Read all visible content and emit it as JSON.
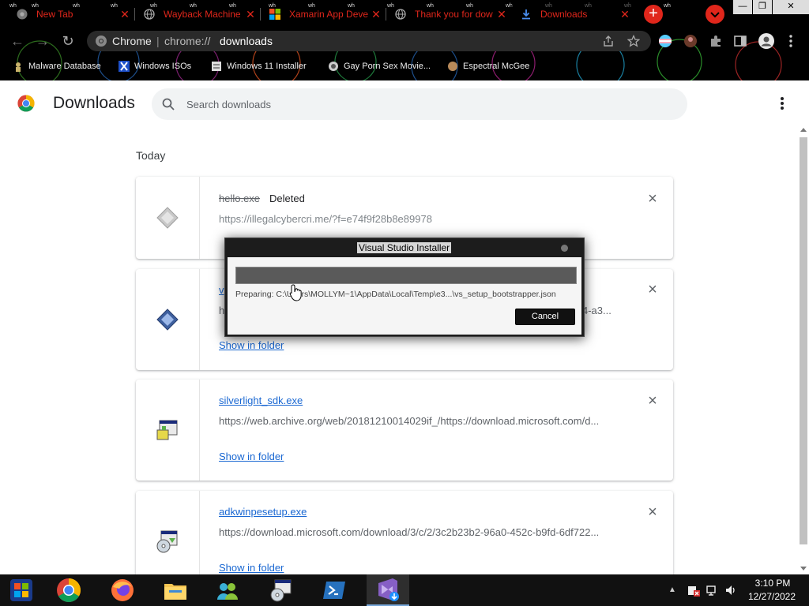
{
  "browser": {
    "tabs": [
      {
        "title": "New Tab",
        "icon": "chrome-icon",
        "active": false
      },
      {
        "title": "Wayback Machine",
        "icon": "globe-icon",
        "active": false
      },
      {
        "title": "Xamarin App Deve",
        "icon": "microsoft-icon",
        "active": false
      },
      {
        "title": "Thank you for dow",
        "icon": "globe-icon",
        "active": false
      },
      {
        "title": "Downloads",
        "icon": "download-icon",
        "active": true
      }
    ],
    "omnibox": {
      "site_label": "Chrome",
      "divider": "|",
      "url_scheme": "chrome://",
      "url_host": "downloads"
    },
    "bookmarks": [
      {
        "label": "Malware Database",
        "icon": "bug-icon"
      },
      {
        "label": "Windows ISOs",
        "icon": "x-logo-icon"
      },
      {
        "label": "Windows 11 Installer",
        "icon": "page-icon"
      },
      {
        "label": "Gay Porn Sex Movie...",
        "icon": "site-icon"
      },
      {
        "label": "Espectral McGee",
        "icon": "site-icon"
      }
    ],
    "theme_color": "#e0261b"
  },
  "downloads": {
    "title": "Downloads",
    "search_placeholder": "Search downloads",
    "section": "Today",
    "show_in_folder": "Show in folder",
    "items": [
      {
        "name": "hello.exe",
        "status": "Deleted",
        "url": "https://illegalcybercri.me/?f=e74f9f28b8e89978",
        "deleted": true
      },
      {
        "name": "v",
        "status": "",
        "url": "h",
        "url_tail": "4-a3...",
        "deleted": false
      },
      {
        "name": "silverlight_sdk.exe",
        "status": "",
        "url": "https://web.archive.org/web/20181210014029if_/https://download.microsoft.com/d...",
        "deleted": false
      },
      {
        "name": "adkwinpesetup.exe",
        "status": "",
        "url": "https://download.microsoft.com/download/3/c/2/3c2b23b2-96a0-452c-b9fd-6df722...",
        "deleted": false
      }
    ],
    "link_color": "#1967d2"
  },
  "installer": {
    "title": "Visual Studio Installer",
    "status": "Preparing: C:\\Users\\MOLLYM~1\\AppData\\Local\\Temp\\e3...\\vs_setup_bootstrapper.json",
    "cancel": "Cancel"
  },
  "taskbar": {
    "apps": [
      "start-icon",
      "chrome-icon",
      "firefox-icon",
      "file-explorer-icon",
      "people-icon",
      "installer-icon",
      "powershell-icon",
      "visual-studio-icon"
    ],
    "time": "3:10 PM",
    "date": "12/27/2022"
  }
}
